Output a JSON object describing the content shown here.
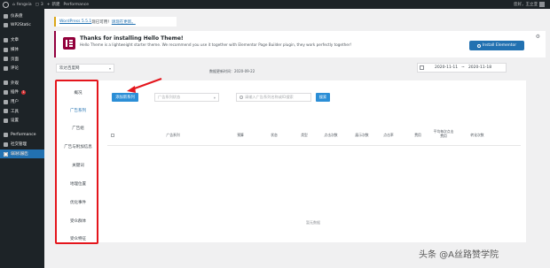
{
  "adminbar": {
    "site_name": "fengxia",
    "comments": "3",
    "new_label": "新建",
    "performance_label": "Performance",
    "user_label": "您好，王立亚"
  },
  "sidebar": {
    "items": [
      {
        "label": "仪表盘",
        "icon": "dashboard-icon"
      },
      {
        "label": "WP2Static",
        "icon": "static-icon"
      },
      {
        "label": "文章",
        "icon": "pin-icon"
      },
      {
        "label": "媒体",
        "icon": "media-icon"
      },
      {
        "label": "页面",
        "icon": "page-icon"
      },
      {
        "label": "评论",
        "icon": "comment-icon"
      },
      {
        "label": "外观",
        "icon": "brush-icon"
      },
      {
        "label": "插件",
        "icon": "plugin-icon",
        "badge": "1"
      },
      {
        "label": "用户",
        "icon": "user-icon"
      },
      {
        "label": "工具",
        "icon": "wrench-icon"
      },
      {
        "label": "设置",
        "icon": "settings-icon"
      },
      {
        "label": "Performance",
        "icon": "performance-icon"
      },
      {
        "label": "社交管理",
        "icon": "social-icon"
      },
      {
        "label": "SEM 报告",
        "icon": "report-icon",
        "active": true
      }
    ],
    "collapse_label": "收起菜单"
  },
  "update_notice": {
    "link_text": "WordPress 5.5.1",
    "middle_text": "现已可用！",
    "action_text": "请现在更新。"
  },
  "theme_notice": {
    "title": "Thanks for installing Hello Theme!",
    "description": "Hello Theme is a lightweight starter theme. We recommend you use it together with Elementor Page Builder plugin, they work perfectly together!",
    "button_label": "Install Elementor",
    "accent_color": "#93003f"
  },
  "filters": {
    "account": "欢达百度网",
    "update_time": "数据更新时间：2020-09-22",
    "date_from": "2020-11-11",
    "date_to": "2020-11-18"
  },
  "tabs": [
    {
      "label": "概况"
    },
    {
      "label": "广告系列",
      "active": true
    },
    {
      "label": "广告组"
    },
    {
      "label": "广告与附加信息"
    },
    {
      "label": "关键词"
    },
    {
      "label": "地理位置"
    },
    {
      "label": "优化事件"
    },
    {
      "label": "受众群体"
    },
    {
      "label": "受众特征"
    }
  ],
  "main": {
    "add_button": "添加新系列",
    "series_placeholder": "广告系列状态",
    "search_placeholder": "请输入广告系列名称或ID搜索",
    "search_button": "搜索",
    "columns": [
      "广告系列",
      "预算",
      "状态",
      "类型",
      "点击次数",
      "展示次数",
      "点击率",
      "费用",
      "平均每次点击费用",
      "转化次数"
    ],
    "empty_text": "暂无数据"
  },
  "watermark": "头条 @A丝路赞学院",
  "colors": {
    "admin_bar": "#1d2327",
    "primary_blue": "#2271b1",
    "button_blue": "#2b8ed6",
    "highlight_red": "#e4151c"
  }
}
